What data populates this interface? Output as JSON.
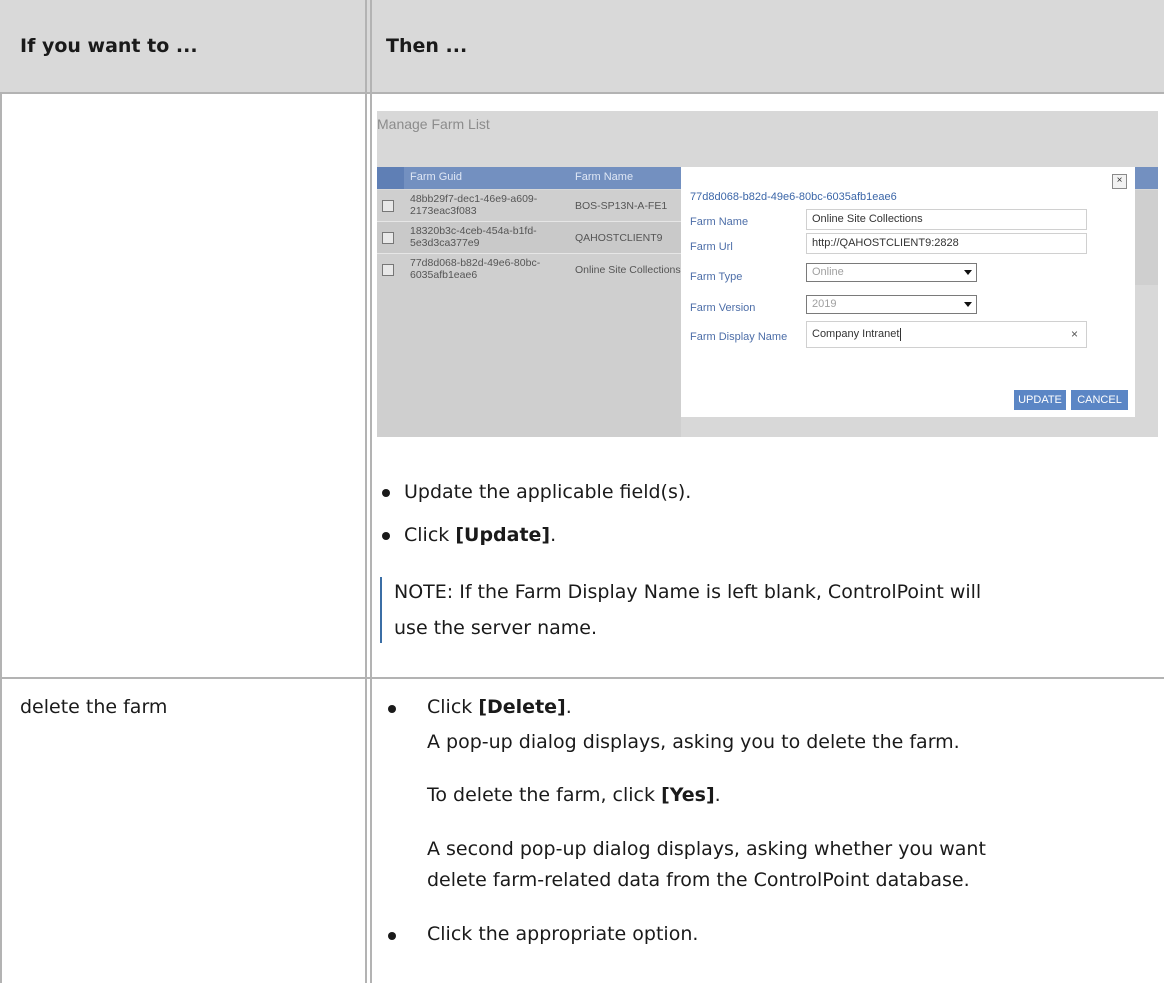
{
  "table": {
    "col1_header": "If you want to ...",
    "col2_header": "Then ..."
  },
  "screenshot": {
    "title": "Manage Farm List",
    "grid_headers": [
      "Farm Guid",
      "Farm Name"
    ],
    "rows": [
      {
        "guid_line1": "48bb29f7-dec1-46e9-a609-",
        "guid_line2": "2173eac3f083",
        "name": "BOS-SP13N-A-FE1"
      },
      {
        "guid_line1": "18320b3c-4ceb-454a-b1fd-",
        "guid_line2": "5e3d3ca377e9",
        "name": "QAHOSTCLIENT9"
      },
      {
        "guid_line1": "77d8d068-b82d-49e6-80bc-",
        "guid_line2": "6035afb1eae6",
        "name": "Online Site Collections"
      }
    ],
    "dialog": {
      "guid": "77d8d068-b82d-49e6-80bc-6035afb1eae6",
      "close": "×",
      "farm_name_label": "Farm Name",
      "farm_name_value": "Online Site Collections",
      "farm_url_label": "Farm Url",
      "farm_url_value": "http://QAHOSTCLIENT9:2828",
      "farm_type_label": "Farm Type",
      "farm_type_value": "Online",
      "farm_version_label": "Farm Version",
      "farm_version_value": "2019",
      "display_name_label": "Farm Display Name",
      "display_name_value": "Company Intranet",
      "clear": "×",
      "update_label": "UPDATE",
      "cancel_label": "CANCEL"
    }
  },
  "row1": {
    "bullet1": "Update the applicable field(s).",
    "bullet2_prefix": "Click ",
    "bullet2_bold": "[Update]",
    "bullet2_suffix": ".",
    "note_line1": "NOTE:  If the Farm Display Name is left blank, ControlPoint will",
    "note_line2": "use the server name."
  },
  "row2": {
    "action": "delete the farm",
    "bullet1_prefix": "Click ",
    "bullet1_bold": "[Delete]",
    "bullet1_suffix": ".",
    "line2": "A pop-up dialog displays, asking you to delete the farm.",
    "line3_prefix": "To delete the farm, click ",
    "line3_bold": "[Yes]",
    "line3_suffix": ".",
    "line4": "A second pop-up dialog displays, asking whether you want",
    "line5": "delete farm-related data from the ControlPoint database.",
    "bullet2": "Click the appropriate option."
  }
}
